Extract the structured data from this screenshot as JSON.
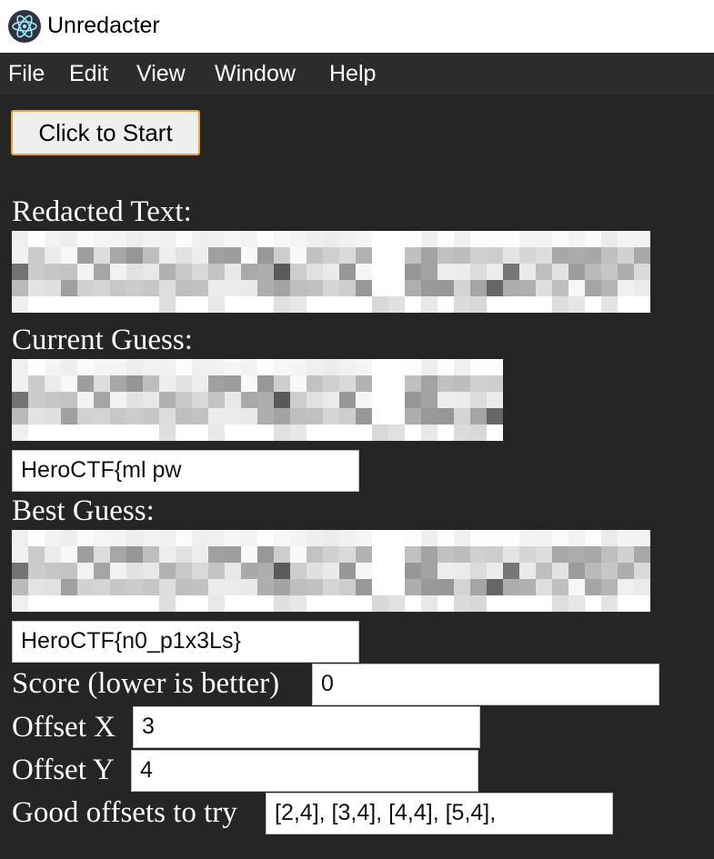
{
  "window": {
    "title": "Unredacter",
    "icon": "electron-atom-icon"
  },
  "menu": {
    "items": [
      "File",
      "Edit",
      "View",
      "Window",
      "Help"
    ]
  },
  "controls": {
    "start_label": "Click to Start"
  },
  "sections": {
    "redacted_label": "Redacted Text:",
    "current_label": "Current Guess:",
    "best_label": "Best Guess:"
  },
  "current_guess": {
    "text": "HeroCTF{ml  pw"
  },
  "best_guess": {
    "text": "HeroCTF{n0_p1x3Ls}"
  },
  "score": {
    "label": "Score (lower is better)",
    "value": "0"
  },
  "offset_x": {
    "label": "Offset X",
    "value": "3"
  },
  "offset_y": {
    "label": "Offset Y",
    "value": "4"
  },
  "good_offsets": {
    "label": "Good offsets to try",
    "value": "[2,4], [3,4], [4,4], [5,4], "
  },
  "colors": {
    "background": "#252525",
    "menubar": "#2c2c2c",
    "button_border": "#e8a33d"
  }
}
